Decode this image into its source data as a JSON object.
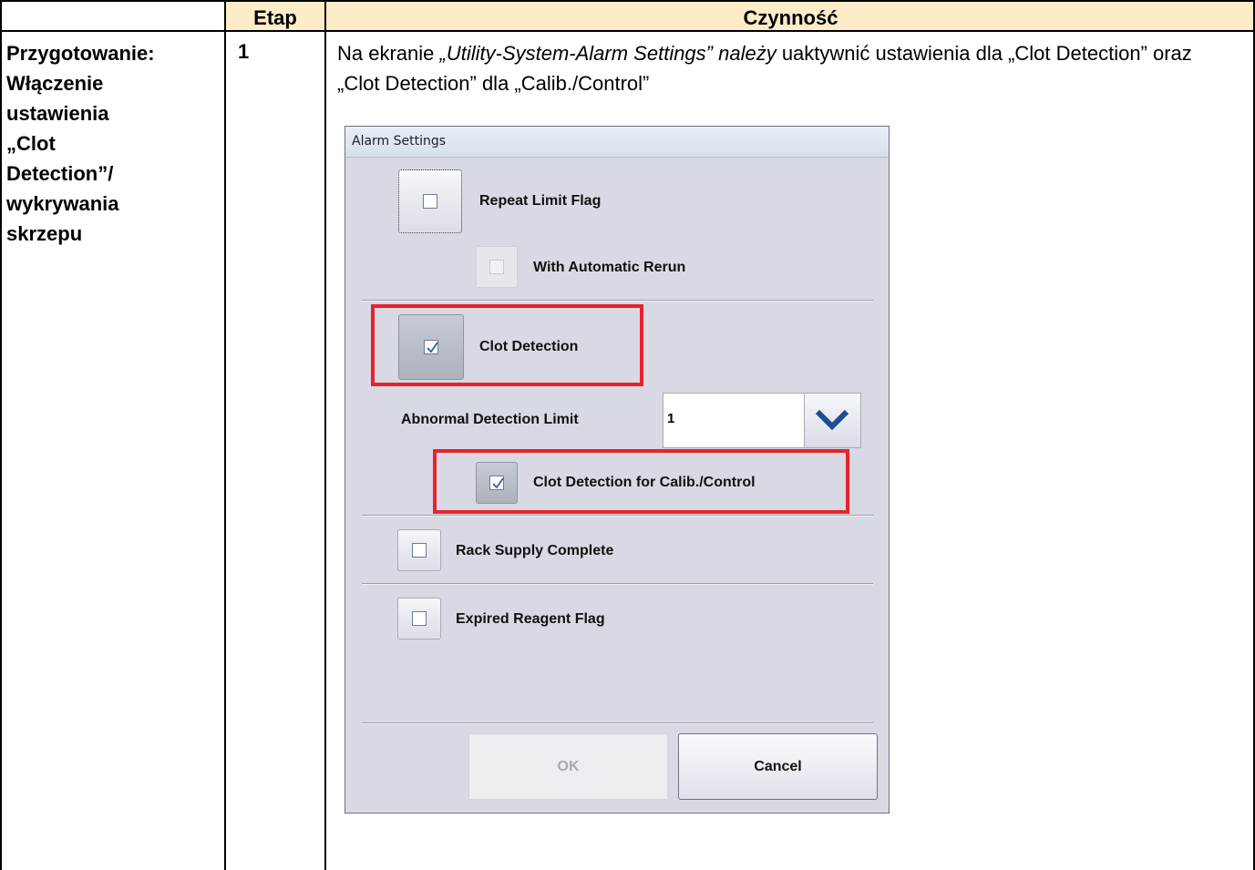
{
  "table": {
    "header_etap": "Etap",
    "header_czynnosc": "Czynność",
    "stage_lines": [
      "Przygotowanie:",
      "Włączenie",
      "ustawienia",
      "„Clot",
      "Detection”/",
      "wykrywania",
      "skrzepu"
    ],
    "step_number": "1",
    "instruction_part1": "Na ekranie ",
    "instruction_italic": "„Utility-System-Alarm Settings” należy",
    "instruction_part2": " uaktywnić ustawienia dla „Clot Detection” oraz „Clot Detection” dla „Calib./Control”"
  },
  "dialog": {
    "title": "Alarm Settings",
    "repeat_limit_flag": {
      "label": "Repeat Limit Flag",
      "checked": false
    },
    "with_automatic_rerun": {
      "label": "With Automatic Rerun",
      "checked": false,
      "enabled": false
    },
    "clot_detection": {
      "label": "Clot Detection",
      "checked": true
    },
    "abnormal_detection_limit": {
      "label": "Abnormal Detection Limit",
      "value": "1"
    },
    "clot_detection_calib": {
      "label": "Clot Detection for Calib./Control",
      "checked": true
    },
    "rack_supply_complete": {
      "label": "Rack Supply Complete",
      "checked": false
    },
    "expired_reagent_flag": {
      "label": "Expired Reagent Flag",
      "checked": false
    },
    "ok_label": "OK",
    "cancel_label": "Cancel"
  },
  "colors": {
    "header_bg": "#fdecc8",
    "highlight": "#e8222d",
    "dialog_bg": "#d8d9e3",
    "check_color": "#2a5fa8"
  }
}
